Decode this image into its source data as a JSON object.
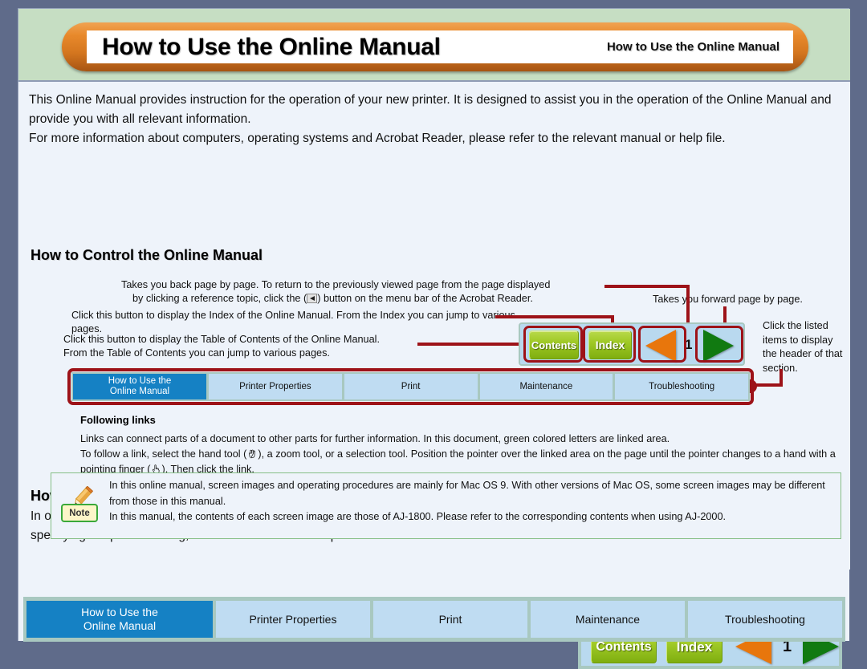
{
  "header": {
    "title": "How to Use the Online Manual",
    "subtitle": "How to Use the Online Manual"
  },
  "intro": {
    "paragraph1": "This Online Manual provides instruction for the operation of your new printer. It is designed to assist you in the operation of the Online Manual and provide you with all relevant information.",
    "paragraph2": "For more information about computers, operating systems and Acrobat Reader, please refer to the relevant manual or help file."
  },
  "sections": {
    "control_heading": "How to Control the Online Manual",
    "print_heading": "How to Print Out the Online Manual",
    "print_body": "In order to print out a hard copy of the Online Manual for your reference, go to Acrobat Reader, click the \"File\" menu, and select \"Print\". After specifying the printer setting, click the \"Print\" button to print."
  },
  "callouts": {
    "back_button_line1": "Takes you back page by page. To return to the previously viewed page from the page displayed",
    "back_button_line2a": "by clicking a reference topic, click the (",
    "back_button_line2b": ") button on the menu bar of the Acrobat Reader.",
    "index_button": "Click this button to display the Index of the Online Manual. From the Index you can jump to various pages.",
    "contents_button_line1": "Click this button to display the Table of Contents of the Online Manual.",
    "contents_button_line2": "From the Table of Contents you can jump to various pages.",
    "forward_button": "Takes you forward page by page.",
    "tab_bar": "Click the listed items to display the header of that section."
  },
  "following_links": {
    "heading": "Following links",
    "line1": "Links can connect parts of a document to other parts for further information. In this document, green colored letters are linked area.",
    "line2a": "To follow a link, select the hand tool (",
    "line2b": "), a zoom tool, or a selection tool. Position the pointer over the linked area on the page until the pointer changes to a hand with a pointing finger (",
    "line2c": "). Then click the link."
  },
  "note": {
    "label": "Note",
    "line1": "In this online manual, screen images and operating procedures are mainly for Mac OS 9. With other versions of Mac OS, some screen images may be different from those in this manual.",
    "line2": "In this manual, the contents of each screen image are those of AJ-1800. Please refer to the corresponding contents when using AJ-2000."
  },
  "navigation": {
    "contents_label": "Contents",
    "index_label": "Index",
    "page_number": "1",
    "prev_icon": "left-triangle-icon",
    "next_icon": "right-triangle-icon"
  },
  "tabs": [
    {
      "line1": "How to Use the",
      "line2": "Online Manual",
      "active": true
    },
    {
      "line1": "Printer Properties",
      "line2": "",
      "active": false
    },
    {
      "line1": "Print",
      "line2": "",
      "active": false
    },
    {
      "line1": "Maintenance",
      "line2": "",
      "active": false
    },
    {
      "line1": "Troubleshooting",
      "line2": "",
      "active": false
    }
  ],
  "colors": {
    "page_border": "#5f6b8a",
    "header_band": "#c6dec3",
    "header_pill": "#e8892b",
    "content_bg": "#eef3fa",
    "connector_red": "#9d1218",
    "tab_inactive": "#bfdcf2",
    "tab_active": "#1581c4",
    "button_green": "#9fc926",
    "prev_orange": "#e8760c",
    "next_green": "#117a11",
    "note_border": "#86bf86"
  }
}
